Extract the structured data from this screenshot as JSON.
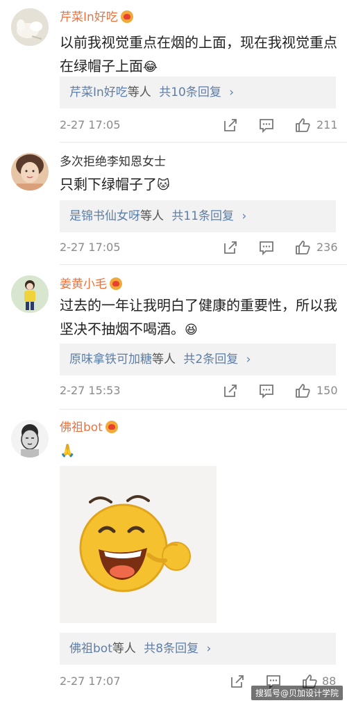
{
  "comments": [
    {
      "username": "芹菜In好吃",
      "text": "以前我视觉重点在烟的上面，现在我视觉重点在绿帽子上面",
      "emoji": "😂",
      "reply_users": "芹菜In好吃",
      "reply_suffix": "等人",
      "reply_count": "共10条回复",
      "chevron": "›",
      "time": "2-27 17:05",
      "likes": "211"
    },
    {
      "username": "多次拒绝李知恩女士",
      "text": "只剩下绿帽子了",
      "emoji": "🐱",
      "reply_users": "是锦书仙女呀",
      "reply_suffix": "等人",
      "reply_count": "共11条回复",
      "chevron": "›",
      "time": "2-27 17:05",
      "likes": "236"
    },
    {
      "username": "姜黄小毛",
      "text": "过去的一年让我明白了健康的重要性，所以我坚决不抽烟不喝酒。",
      "emoji": "😆",
      "reply_users": "原味拿铁可加糖",
      "reply_suffix": "等人",
      "reply_count": "共2条回复",
      "chevron": "›",
      "time": "2-27 15:53",
      "likes": "150"
    },
    {
      "username": "佛祖bot",
      "text": "",
      "emoji": "🙏",
      "reply_users": "佛祖bot",
      "reply_suffix": "等人",
      "reply_count": "共8条回复",
      "chevron": "›",
      "time": "2-27 17:07",
      "likes": "88"
    }
  ],
  "watermark": "搜狐号@贝加设计学院",
  "colors": {
    "accent": "#eb7340",
    "link": "#5d7ea8",
    "muted": "#8a8a8a"
  }
}
